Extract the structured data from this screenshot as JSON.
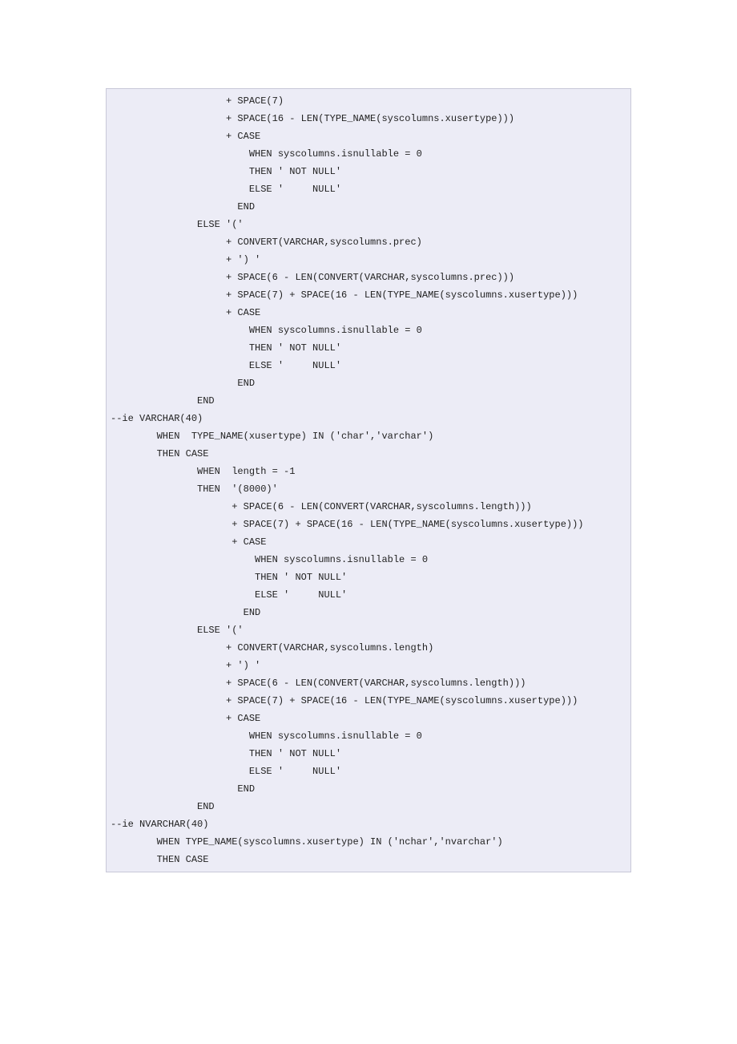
{
  "code": {
    "lines": [
      "                    + SPACE(7)",
      "                    + SPACE(16 - LEN(TYPE_NAME(syscolumns.xusertype)))",
      "                    + CASE",
      "                        WHEN syscolumns.isnullable = 0",
      "                        THEN ' NOT NULL'",
      "                        ELSE '     NULL'",
      "                      END",
      "               ELSE '('",
      "                    + CONVERT(VARCHAR,syscolumns.prec)",
      "                    + ') '",
      "                    + SPACE(6 - LEN(CONVERT(VARCHAR,syscolumns.prec)))",
      "                    + SPACE(7) + SPACE(16 - LEN(TYPE_NAME(syscolumns.xusertype)))",
      "                    + CASE",
      "                        WHEN syscolumns.isnullable = 0",
      "                        THEN ' NOT NULL'",
      "                        ELSE '     NULL'",
      "                      END",
      "               END",
      "--ie VARCHAR(40)",
      "        WHEN  TYPE_NAME(xusertype) IN ('char','varchar')",
      "        THEN CASE",
      "               WHEN  length = -1",
      "               THEN  '(8000)'",
      "                     + SPACE(6 - LEN(CONVERT(VARCHAR,syscolumns.length)))",
      "                     + SPACE(7) + SPACE(16 - LEN(TYPE_NAME(syscolumns.xusertype)))",
      "                     + CASE",
      "                         WHEN syscolumns.isnullable = 0",
      "                         THEN ' NOT NULL'",
      "                         ELSE '     NULL'",
      "                       END",
      "               ELSE '('",
      "                    + CONVERT(VARCHAR,syscolumns.length)",
      "                    + ') '",
      "                    + SPACE(6 - LEN(CONVERT(VARCHAR,syscolumns.length)))",
      "                    + SPACE(7) + SPACE(16 - LEN(TYPE_NAME(syscolumns.xusertype)))",
      "                    + CASE",
      "                        WHEN syscolumns.isnullable = 0",
      "                        THEN ' NOT NULL'",
      "                        ELSE '     NULL'",
      "                      END",
      "               END",
      "--ie NVARCHAR(40)",
      "        WHEN TYPE_NAME(syscolumns.xusertype) IN ('nchar','nvarchar')",
      "        THEN CASE"
    ]
  }
}
